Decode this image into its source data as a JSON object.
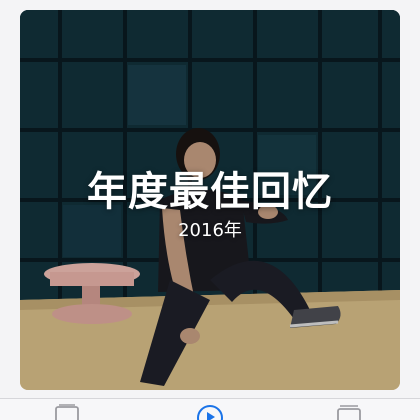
{
  "memory": {
    "title": "年度最佳回忆",
    "subtitle": "2016年"
  },
  "tab_bar": {
    "icons": [
      "photos-tab-icon",
      "memories-tab-icon",
      "albums-tab-icon"
    ],
    "active": "memories-tab-icon",
    "active_color": "#1a73e8"
  },
  "colors": {
    "background": "#f4f4f6",
    "title_text": "#ffffff"
  }
}
